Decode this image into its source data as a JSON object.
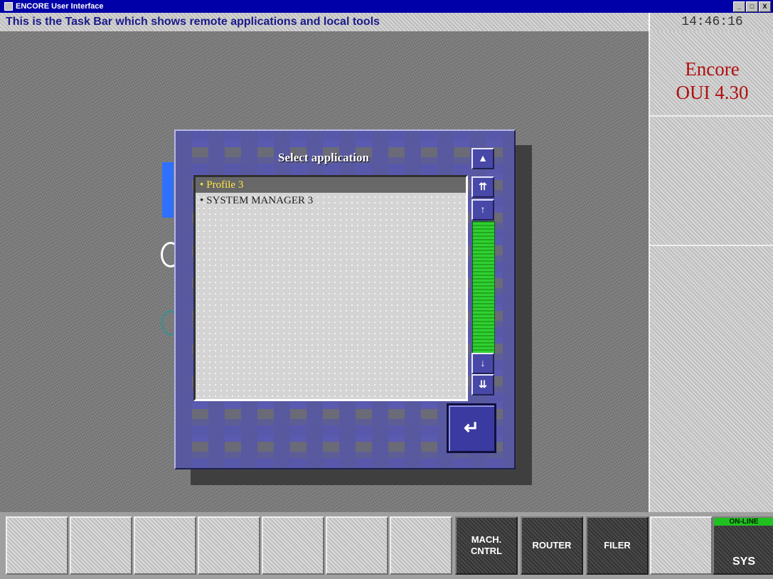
{
  "window": {
    "title": "ENCORE User Interface",
    "minimize_label": "_",
    "maximize_label": "□",
    "close_label": "X"
  },
  "taskbar_message": "This is the Task Bar which shows remote applications and local tools",
  "clock": "14:46:16",
  "brand": {
    "line1": "Encore",
    "line2": "OUI 4.30"
  },
  "dialog": {
    "title": "Select application",
    "items": [
      {
        "bullet": "•",
        "label": "Profile 3",
        "selected": true
      },
      {
        "bullet": "•",
        "label": "SYSTEM MANAGER 3",
        "selected": false
      }
    ],
    "scroll_buttons": {
      "top": "▲",
      "page_up": "⇈",
      "up": "↑",
      "down": "↓",
      "page_down": "⇊"
    },
    "enter_glyph": "↵"
  },
  "bottom_bar": {
    "mach_line1": "MACH.",
    "mach_line2": "CNTRL",
    "router": "ROUTER",
    "filer": "FILER",
    "sys_status": "ON-LINE",
    "sys_label": "SYS"
  },
  "colors": {
    "title_bar": "#0000a8",
    "brand_text": "#b01010",
    "selected_item_text": "#ffe640",
    "online_indicator": "#20c020"
  }
}
